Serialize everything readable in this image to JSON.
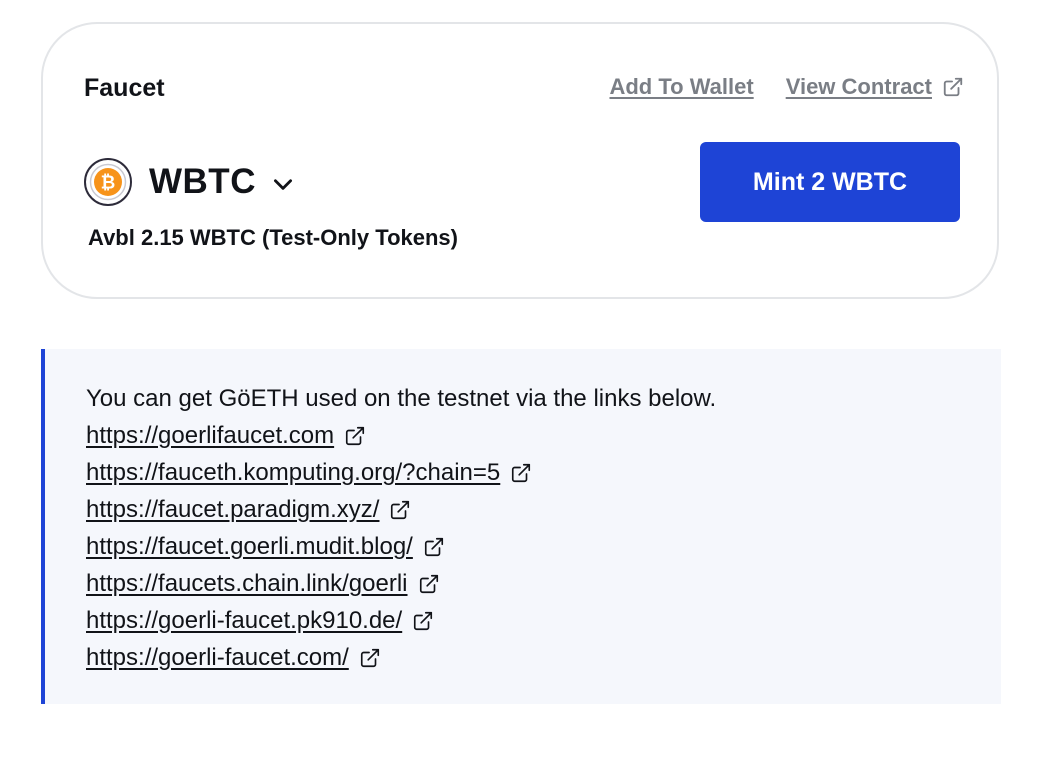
{
  "faucet": {
    "title": "Faucet",
    "add_to_wallet": "Add To Wallet",
    "view_contract": "View Contract",
    "token_symbol": "WBTC",
    "token_icon": "bitcoin-icon",
    "balance_text": "Avbl 2.15 WBTC (Test-Only Tokens)",
    "mint_label": "Mint 2 WBTC"
  },
  "info": {
    "text": "You can get GöETH used on the testnet via the links below.",
    "links": [
      "https://goerlifaucet.com",
      "https://fauceth.komputing.org/?chain=5",
      "https://faucet.paradigm.xyz/",
      "https://faucet.goerli.mudit.blog/",
      "https://faucets.chain.link/goerli",
      "https://goerli-faucet.pk910.de/",
      "https://goerli-faucet.com/"
    ]
  },
  "colors": {
    "accent": "#1e44d6",
    "bitcoin_orange": "#f7931a",
    "muted_link": "#7a7e85",
    "info_bg": "#f5f7fc"
  }
}
